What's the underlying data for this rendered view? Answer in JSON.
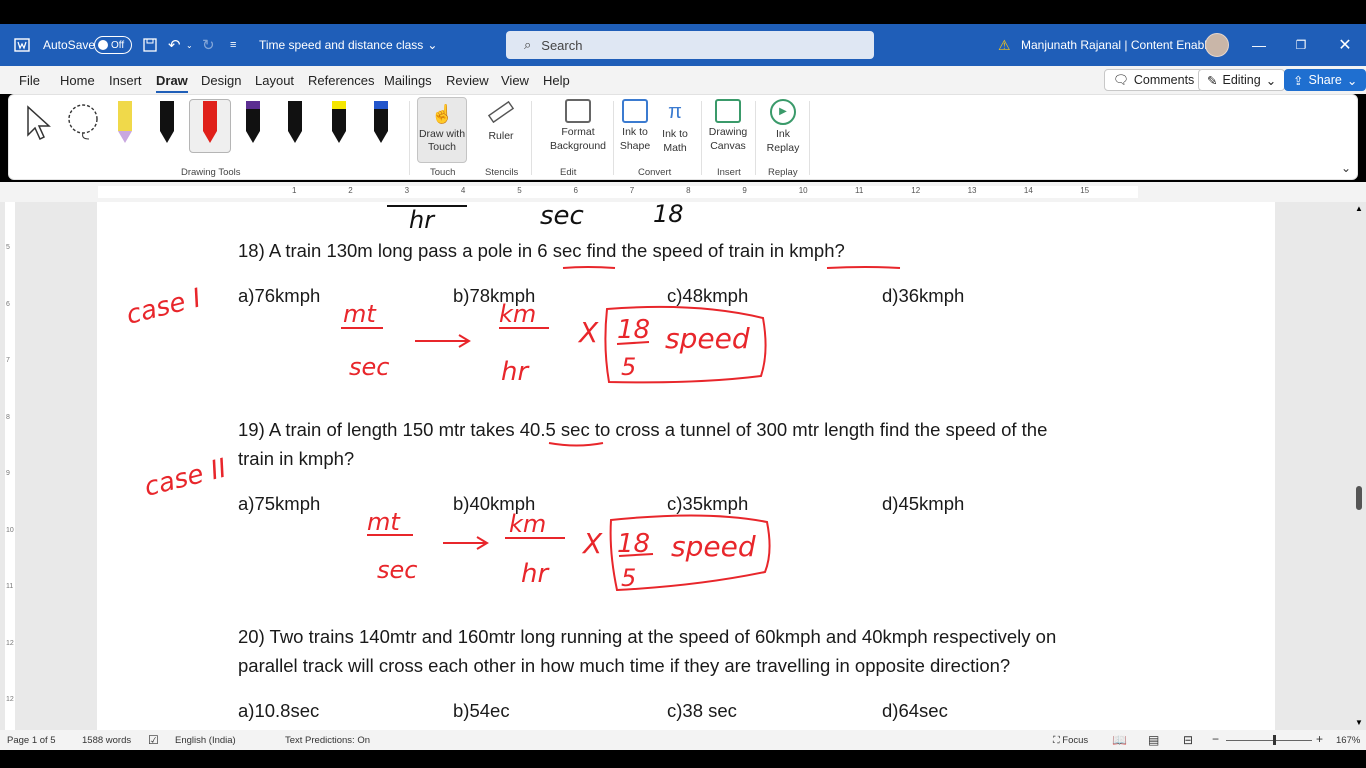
{
  "titlebar": {
    "autosave_label": "AutoSave",
    "autosave_state": "Off",
    "doc_title": "Time speed and distance class",
    "search_placeholder": "Search",
    "user_name": "Manjunath Rajanal | Content Enablers"
  },
  "menu": {
    "tabs": [
      "File",
      "Home",
      "Insert",
      "Draw",
      "Design",
      "Layout",
      "References",
      "Mailings",
      "Review",
      "View",
      "Help"
    ],
    "active_tab": "Draw",
    "comments_label": "Comments",
    "editing_label": "Editing",
    "share_label": "Share"
  },
  "ribbon": {
    "groups": {
      "drawing_tools": "Drawing Tools",
      "touch": "Touch",
      "stencils": "Stencils",
      "edit": "Edit",
      "convert": "Convert",
      "insert": "Insert",
      "replay": "Replay"
    },
    "buttons": {
      "draw_with_touch": "Draw with Touch",
      "ruler": "Ruler",
      "format_background": "Format Background",
      "ink_to_shape": "Ink to Shape",
      "ink_to_math": "Ink to Math",
      "drawing_canvas": "Drawing Canvas",
      "ink_replay": "Ink Replay"
    },
    "pen_colors": [
      "#f0d94a",
      "#111111",
      "#e0201a",
      "#5b2e91",
      "#111111",
      "#f5e600",
      "#2255cc"
    ]
  },
  "ruler_numbers": [
    "1",
    "2",
    "3",
    "4",
    "5",
    "6",
    "7",
    "8",
    "9",
    "10",
    "11",
    "12",
    "13",
    "14",
    "15"
  ],
  "vruler_numbers": [
    "5",
    "6",
    "7",
    "8",
    "9",
    "10",
    "11",
    "12",
    "12"
  ],
  "document": {
    "q18": "18)  A train 130m long pass a pole in 6 sec find the speed of train in kmph?",
    "q18_options": [
      "a)76kmph",
      "b)78kmph",
      "c)48kmph",
      "d)36kmph"
    ],
    "q19_line1": "19) A train of length 150 mtr takes 40.5 sec to cross a tunnel of 300 mtr length find the speed of the",
    "q19_line2": "train in kmph?",
    "q19_options": [
      "a)75kmph",
      "b)40kmph",
      "c)35kmph",
      "d)45kmph"
    ],
    "q20_line1": "20) Two trains 140mtr and 160mtr long running at the speed of 60kmph and 40kmph respectively on",
    "q20_line2": "parallel track will cross each other in how much time if they are travelling in opposite direction?",
    "q20_options": [
      "a)10.8sec",
      "b)54ec",
      "c)38 sec",
      "d)64sec"
    ]
  },
  "ink": {
    "top_remnant_1": "hr",
    "top_remnant_2": "sec",
    "top_remnant_3": "18",
    "case1": "case I",
    "case2": "case II",
    "frac1_num": "mt",
    "frac1_den": "sec",
    "frac2_num": "km",
    "frac2_den": "hr",
    "times": "X",
    "box_num": "18",
    "box_den": "5",
    "box_word": "speed",
    "ink_color": "#e8262b"
  },
  "status": {
    "page": "Page 1 of 5",
    "words": "1588 words",
    "language": "English (India)",
    "predictions": "Text Predictions: On",
    "focus": "Focus",
    "zoom": "167%"
  }
}
